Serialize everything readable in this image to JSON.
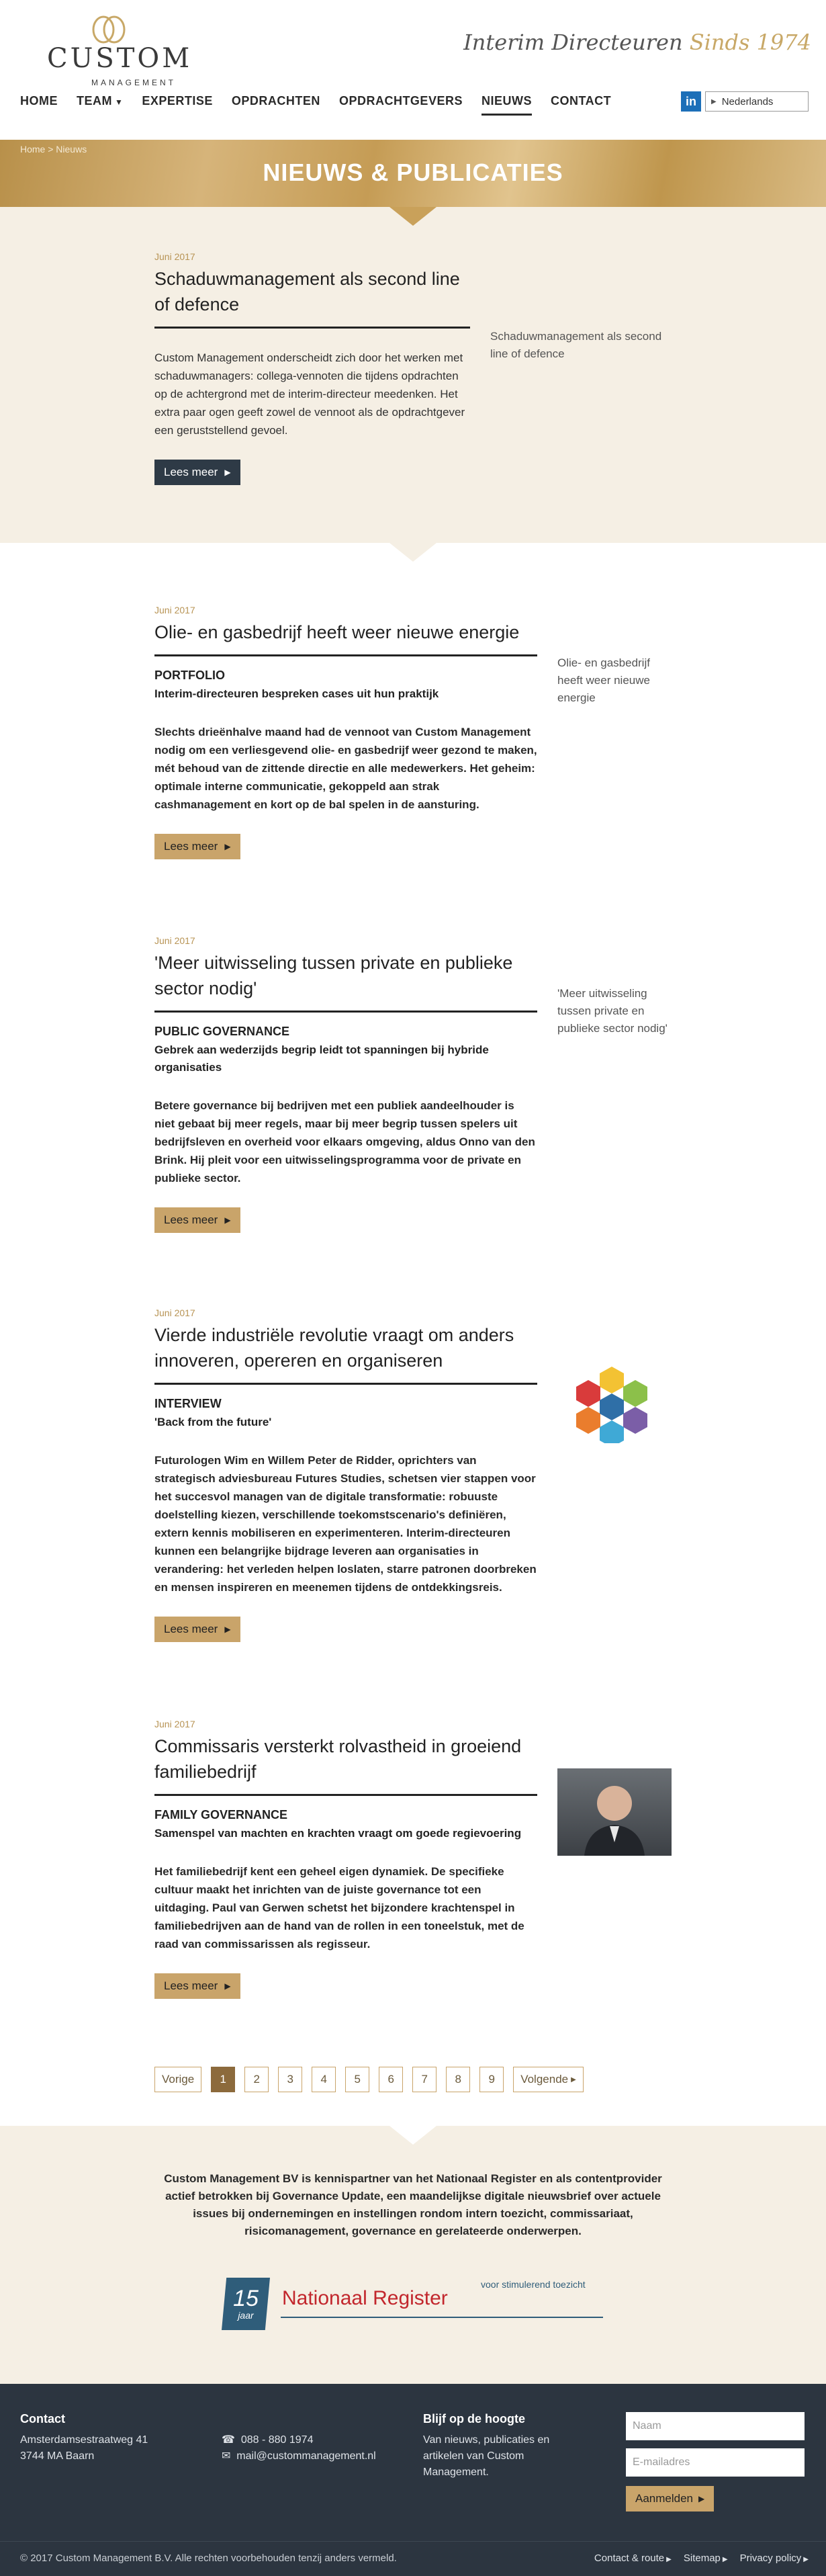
{
  "header": {
    "logo_text": "CUSTOM",
    "logo_sub": "MANAGEMENT",
    "tagline_main": "Interim Directeuren",
    "tagline_accent": "Sinds 1974"
  },
  "nav": {
    "items": [
      {
        "label": "HOME"
      },
      {
        "label": "TEAM"
      },
      {
        "label": "EXPERTISE"
      },
      {
        "label": "OPDRACHTEN"
      },
      {
        "label": "OPDRACHTGEVERS"
      },
      {
        "label": "NIEUWS"
      },
      {
        "label": "CONTACT"
      }
    ],
    "linkedin": "in",
    "language": "Nederlands"
  },
  "banner": {
    "breadcrumb": "Home > Nieuws",
    "title": "NIEUWS & PUBLICATIES"
  },
  "articles": [
    {
      "date": "Juni 2017",
      "title": "Schaduwmanagement als second line of defence",
      "body": "Custom Management onderscheidt zich door het werken met schaduwmanagers: collega-vennoten die tijdens opdrachten op de achtergrond met de interim-directeur meedenken. Het extra paar ogen geeft zowel de vennoot als de opdrachtgever een geruststellend gevoel.",
      "side": "Schaduwmanagement als second line of defence",
      "button": "Lees meer"
    },
    {
      "date": "Juni 2017",
      "title": "Olie- en gasbedrijf heeft weer nieuwe energie",
      "category": "PORTFOLIO",
      "subtitle": "Interim-directeuren bespreken cases uit hun praktijk",
      "body": "Slechts drieënhalve maand had de vennoot van Custom Management nodig om een verliesgevend olie- en gasbedrijf weer gezond te maken, mét behoud van de zittende directie en alle medewerkers. Het geheim: optimale interne communicatie, gekoppeld aan strak cashmanagement en kort op de bal spelen in de aansturing.",
      "side": "Olie- en gasbedrijf heeft weer nieuwe energie",
      "button": "Lees meer"
    },
    {
      "date": "Juni 2017",
      "title": "'Meer uitwisseling tussen private en publieke sector nodig'",
      "category": "PUBLIC GOVERNANCE",
      "subtitle": "Gebrek aan wederzijds begrip leidt tot spanningen bij hybride organisaties",
      "body": "Betere governance bij bedrijven met een publiek aandeelhouder is niet gebaat bij meer regels, maar bij meer begrip tussen spelers uit bedrijfsleven en overheid voor elkaars omgeving, aldus Onno van den Brink. Hij pleit voor een uitwisselingsprogramma voor de private en publieke sector.",
      "side": "'Meer uitwisseling tussen private en publieke sector nodig'",
      "button": "Lees meer"
    },
    {
      "date": "Juni 2017",
      "title": "Vierde industriële revolutie vraagt om anders innoveren, opereren en organiseren",
      "category": "INTERVIEW",
      "subtitle": "'Back from the future'",
      "body": "Futurologen Wim en Willem Peter de Ridder, oprichters van strategisch adviesbureau Futures Studies, schetsen vier stappen voor het succesvol managen van de digitale transformatie: robuuste doelstelling kiezen, verschillende toekomstscenario's definiëren, extern kennis mobiliseren en experimenteren. Interim-directeuren kunnen een belangrijke bijdrage leveren aan organisaties in verandering: het verleden helpen loslaten, starre patronen doorbreken en mensen inspireren en meenemen tijdens de ontdekkingsreis.",
      "button": "Lees meer"
    },
    {
      "date": "Juni 2017",
      "title": "Commissaris versterkt rolvastheid in groeiend familiebedrijf",
      "category": "FAMILY GOVERNANCE",
      "subtitle": "Samenspel van machten en krachten vraagt om goede regievoering",
      "body": "Het familiebedrijf kent een geheel eigen dynamiek. De specifieke cultuur maakt het inrichten van de juiste governance tot een uitdaging. Paul van Gerwen schetst het bijzondere krachtenspel in familiebedrijven aan de hand van de rollen in een toneelstuk, met de raad van commissarissen als regisseur.",
      "button": "Lees meer"
    }
  ],
  "pagination": {
    "prev": "Vorige",
    "pages": [
      "1",
      "2",
      "3",
      "4",
      "5",
      "6",
      "7",
      "8",
      "9"
    ],
    "current": "1",
    "next": "Volgende"
  },
  "partner": {
    "text": "Custom Management BV is kennispartner van het Nationaal Register en als contentprovider actief betrokken bij Governance Update, een maandelijkse digitale nieuwsbrief over actuele issues bij ondernemingen en instellingen rondom intern toezicht, commissariaat, risicomanagement, governance en gerelateerde onderwerpen.",
    "badge_number": "15",
    "badge_word": "jaar",
    "register_name": "Nationaal Register",
    "register_sub": "voor stimulerend toezicht"
  },
  "footer": {
    "contact_heading": "Contact",
    "address_line1": "Amsterdamsestraatweg 41",
    "address_line2": "3744 MA Baarn",
    "phone": "088 - 880 1974",
    "email": "mail@custommanagement.nl",
    "newsletter_heading": "Blijf op de hoogte",
    "newsletter_text": "Van nieuws, publicaties en artikelen van Custom Management.",
    "name_placeholder": "Naam",
    "email_placeholder": "E-mailadres",
    "subscribe": "Aanmelden",
    "copyright": "© 2017 Custom Management B.V. Alle rechten voorbehouden tenzij anders vermeld.",
    "links": [
      "Contact & route",
      "Sitemap",
      "Privacy policy"
    ]
  }
}
